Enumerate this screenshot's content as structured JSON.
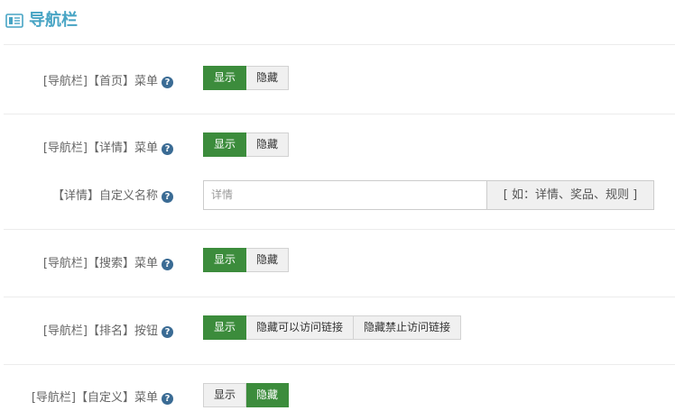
{
  "header": {
    "title": "导航栏",
    "icon": "list-panel-icon",
    "color": "#47a4c4"
  },
  "accent": "#3c8c3c",
  "rows": {
    "home": {
      "label": "[导航栏]【首页】菜单",
      "options": [
        "显示",
        "隐藏"
      ],
      "selected": "显示"
    },
    "detail": {
      "label": "[导航栏]【详情】菜单",
      "options": [
        "显示",
        "隐藏"
      ],
      "selected": "显示"
    },
    "detail_name": {
      "label": "【详情】自定义名称",
      "placeholder": "详情",
      "hint": "[ 如：详情、奖品、规则 ]"
    },
    "search": {
      "label": "[导航栏]【搜索】菜单",
      "options": [
        "显示",
        "隐藏"
      ],
      "selected": "显示"
    },
    "rank": {
      "label": "[导航栏]【排名】按钮",
      "options": [
        "显示",
        "隐藏可以访问链接",
        "隐藏禁止访问链接"
      ],
      "selected": "显示"
    },
    "custom": {
      "label": "[导航栏]【自定义】菜单",
      "options": [
        "显示",
        "隐藏"
      ],
      "selected": "隐藏"
    }
  }
}
